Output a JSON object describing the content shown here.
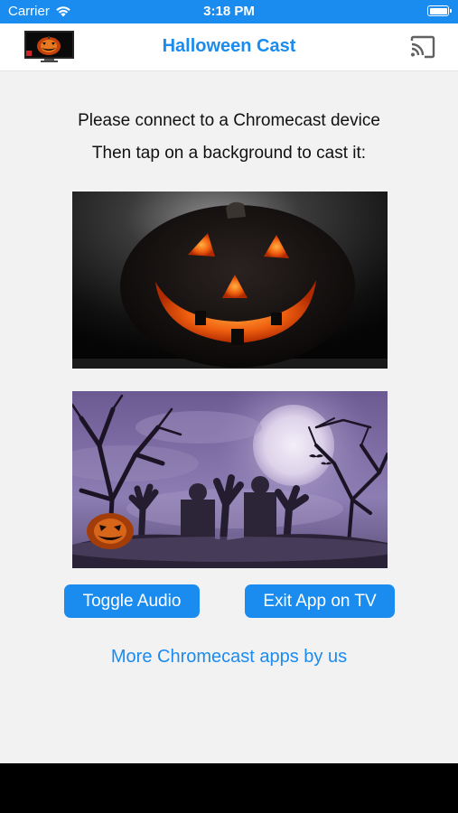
{
  "status_bar": {
    "carrier": "Carrier",
    "time": "3:18 PM",
    "wifi_icon": "wifi-icon",
    "battery_icon": "battery-icon"
  },
  "nav": {
    "title": "Halloween Cast",
    "app_icon": "app-logo-icon",
    "cast_icon": "cast-icon"
  },
  "instructions": {
    "line1": "Please connect to a Chromecast device",
    "line2": "Then tap on a background to cast it:"
  },
  "backgrounds": [
    {
      "name": "jack-o-lantern-background",
      "icon": "jack-o-lantern-image"
    },
    {
      "name": "graveyard-background",
      "icon": "graveyard-moon-image"
    }
  ],
  "buttons": {
    "toggle_audio": "Toggle Audio",
    "exit_app": "Exit App on TV"
  },
  "more_apps_link": "More Chromecast apps by us",
  "colors": {
    "accent": "#1a8cf0",
    "background": "#f2f2f2",
    "nav_background": "#ffffff"
  }
}
